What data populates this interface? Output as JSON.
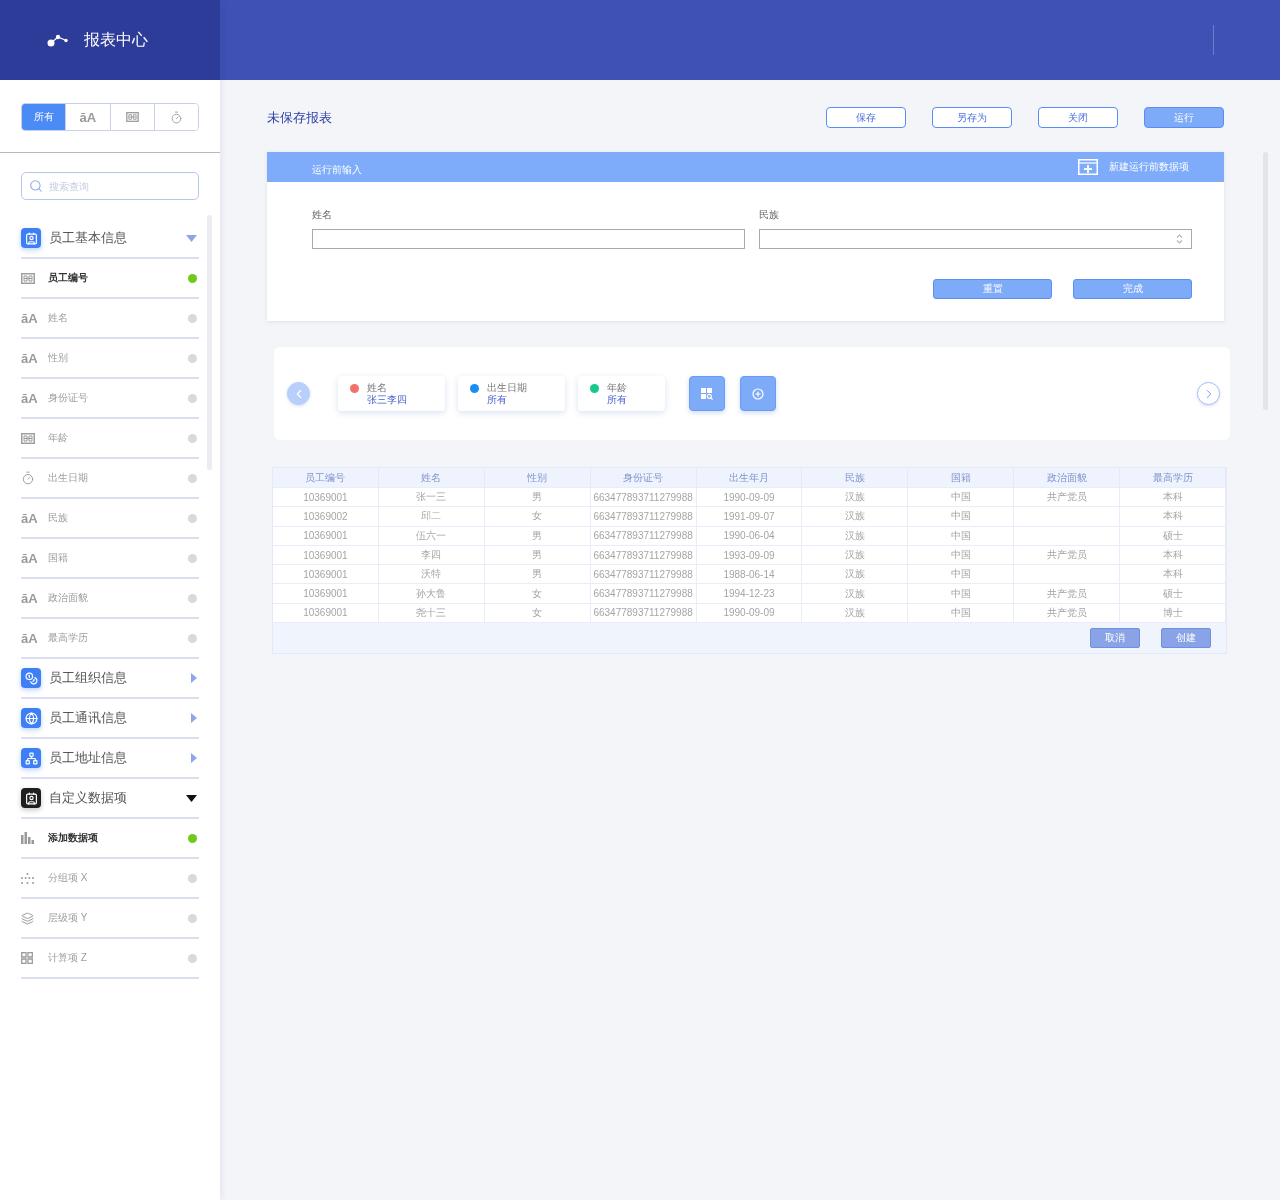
{
  "app": {
    "title": "报表中心"
  },
  "sidebar": {
    "tabs": [
      {
        "kind": "label",
        "text": "所有",
        "selected": true
      },
      {
        "kind": "glyph",
        "text": "āA",
        "selected": false
      },
      {
        "kind": "number",
        "selected": false
      },
      {
        "kind": "date",
        "selected": false
      }
    ],
    "search": {
      "placeholder": "搜索查询"
    },
    "groups": [
      {
        "kind": "person",
        "label": "员工基本信息",
        "expanded": true,
        "selected": false,
        "items": [
          {
            "kind": "number",
            "label": "员工编号",
            "active": true
          },
          {
            "kind": "text",
            "glyph": "āA",
            "label": "姓名",
            "active": false
          },
          {
            "kind": "text",
            "glyph": "āA",
            "label": "性别",
            "active": false
          },
          {
            "kind": "text",
            "glyph": "āA",
            "label": "身份证号",
            "active": false
          },
          {
            "kind": "number",
            "label": "年龄",
            "active": false
          },
          {
            "kind": "date",
            "label": "出生日期",
            "active": false
          },
          {
            "kind": "text",
            "glyph": "āA",
            "label": "民族",
            "active": false
          },
          {
            "kind": "text",
            "glyph": "āA",
            "label": "国籍",
            "active": false
          },
          {
            "kind": "text",
            "glyph": "āA",
            "label": "政治面貌",
            "active": false
          },
          {
            "kind": "text",
            "glyph": "āA",
            "label": "最高学历",
            "active": false
          }
        ]
      },
      {
        "kind": "coins",
        "label": "员工组织信息",
        "expanded": false,
        "selected": false
      },
      {
        "kind": "globe",
        "label": "员工通讯信息",
        "expanded": false,
        "selected": false
      },
      {
        "kind": "org",
        "label": "员工地址信息",
        "expanded": false,
        "selected": false
      },
      {
        "kind": "person",
        "label": "自定义数据项",
        "expanded": true,
        "selected": true,
        "items": [
          {
            "kind": "bars",
            "label": "添加数据项",
            "active": true
          },
          {
            "kind": "dots",
            "label": "分组项 X",
            "active": false
          },
          {
            "kind": "layers",
            "label": "层级项 Y",
            "active": false
          },
          {
            "kind": "tiles",
            "label": "计算项 Z",
            "active": false
          }
        ]
      }
    ]
  },
  "report": {
    "title": "未保存报表",
    "buttons": [
      {
        "label": "保存",
        "kind": "outline"
      },
      {
        "label": "另存为",
        "kind": "outline"
      },
      {
        "label": "关闭",
        "kind": "outline"
      },
      {
        "label": "运行",
        "kind": "primary"
      }
    ]
  },
  "pre_run_input": {
    "title": "运行前输入",
    "add_label": "新建运行前数据项",
    "fields": [
      {
        "label": "姓名",
        "kind": "text"
      },
      {
        "label": "民族",
        "kind": "select"
      }
    ],
    "buttons": [
      "重置",
      "完成"
    ]
  },
  "filters": [
    {
      "label": "姓名",
      "value": "张三李四",
      "color": "#f5706a"
    },
    {
      "label": "出生日期",
      "value": "所有",
      "color": "#1a8cf5"
    },
    {
      "label": "年龄",
      "value": "所有",
      "color": "#16c98b"
    }
  ],
  "table": {
    "columns": [
      "员工编号",
      "姓名",
      "性别",
      "身份证号",
      "出生年月",
      "民族",
      "国籍",
      "政治面貌",
      "最高学历"
    ],
    "rows": [
      {
        "employee_id": "10369001",
        "name": "张一三",
        "gender": "男",
        "id_number": "663477893711279988",
        "birth_date": "1990-09-09",
        "ethnicity": "汉族",
        "nationality": "中国",
        "political_status": "共产党员",
        "education": "本科"
      },
      {
        "employee_id": "10369002",
        "name": "邱二",
        "gender": "女",
        "id_number": "663477893711279988",
        "birth_date": "1991-09-07",
        "ethnicity": "汉族",
        "nationality": "中国",
        "education": "本科"
      },
      {
        "employee_id": "10369001",
        "name": "伍六一",
        "gender": "男",
        "id_number": "663477893711279988",
        "birth_date": "1990-06-04",
        "ethnicity": "汉族",
        "nationality": "中国",
        "education": "硕士"
      },
      {
        "employee_id": "10369001",
        "name": "李四",
        "gender": "男",
        "id_number": "663477893711279988",
        "birth_date": "1993-09-09",
        "ethnicity": "汉族",
        "nationality": "中国",
        "political_status": "共产党员",
        "education": "本科"
      },
      {
        "employee_id": "10369001",
        "name": "沃特",
        "gender": "男",
        "id_number": "663477893711279988",
        "birth_date": "1988-06-14",
        "ethnicity": "汉族",
        "nationality": "中国",
        "education": "本科"
      },
      {
        "employee_id": "10369001",
        "name": "孙大鲁",
        "gender": "女",
        "id_number": "663477893711279988",
        "birth_date": "1994-12-23",
        "ethnicity": "汉族",
        "nationality": "中国",
        "political_status": "共产党员",
        "education": "硕士"
      },
      {
        "employee_id": "10369001",
        "name": "尧十三",
        "gender": "女",
        "id_number": "663477893711279988",
        "birth_date": "1990-09-09",
        "ethnicity": "汉族",
        "nationality": "中国",
        "political_status": "共产党员",
        "education": "博士"
      }
    ],
    "buttons": [
      "取消",
      "创建"
    ]
  }
}
